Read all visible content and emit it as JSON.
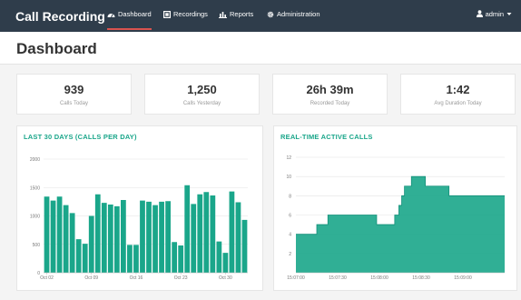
{
  "app": {
    "title": "Call Recording"
  },
  "nav": {
    "items": [
      {
        "label": "Dashboard",
        "icon": "dashboard-icon",
        "active": true
      },
      {
        "label": "Recordings",
        "icon": "recordings-icon",
        "active": false
      },
      {
        "label": "Reports",
        "icon": "bar-chart-icon",
        "active": false
      },
      {
        "label": "Administration",
        "icon": "gear-icon",
        "active": false
      }
    ],
    "user": {
      "label": "admin",
      "icon": "user-icon",
      "caret": "chevron-down-icon"
    }
  },
  "page": {
    "title": "Dashboard"
  },
  "stats": [
    {
      "value": "939",
      "label": "Calls Today"
    },
    {
      "value": "1,250",
      "label": "Calls Yesterday"
    },
    {
      "value": "26h 39m",
      "label": "Recorded Today"
    },
    {
      "value": "1:42",
      "label": "Avg Duration Today"
    }
  ],
  "colors": {
    "navbar": "#2f3d4b",
    "accent": "#1aa68a",
    "active_underline": "#d9534f"
  },
  "chart_data": [
    {
      "type": "bar",
      "title": "LAST 30 DAYS (CALLS PER DAY)",
      "xlabel": "",
      "ylabel": "",
      "ylim": [
        0,
        2000
      ],
      "yticks": [
        0,
        500,
        1000,
        1500,
        2000
      ],
      "xticks": [
        {
          "label": "Oct 02",
          "index": 0
        },
        {
          "label": "Oct 09",
          "index": 7
        },
        {
          "label": "Oct 16",
          "index": 14
        },
        {
          "label": "Oct 23",
          "index": 21
        },
        {
          "label": "Oct 30",
          "index": 28
        }
      ],
      "grid": true,
      "color": "#1aa68a",
      "values": [
        1340,
        1270,
        1340,
        1190,
        1050,
        590,
        510,
        1000,
        1380,
        1230,
        1200,
        1170,
        1280,
        490,
        490,
        1270,
        1250,
        1190,
        1250,
        1260,
        540,
        480,
        1540,
        1210,
        1380,
        1420,
        1360,
        550,
        350,
        1430,
        1240,
        930
      ]
    },
    {
      "type": "area",
      "title": "REAL-TIME ACTIVE CALLS",
      "xlabel": "",
      "ylabel": "",
      "ylim": [
        0,
        12
      ],
      "yticks": [
        2,
        4,
        6,
        8,
        10,
        12
      ],
      "xlim": [
        "15:07:00",
        "15:09:30"
      ],
      "xticks": [
        "15:07:00",
        "15:07:30",
        "15:08:00",
        "15:08:30",
        "15:09:00"
      ],
      "grid": true,
      "step": true,
      "color": "#1aa68a",
      "points": [
        [
          "15:07:00",
          4
        ],
        [
          "15:07:15",
          5
        ],
        [
          "15:07:23",
          6
        ],
        [
          "15:07:58",
          5
        ],
        [
          "15:08:11",
          6
        ],
        [
          "15:08:14",
          7
        ],
        [
          "15:08:16",
          8
        ],
        [
          "15:08:18",
          9
        ],
        [
          "15:08:23",
          10
        ],
        [
          "15:08:33",
          9
        ],
        [
          "15:08:50",
          8
        ],
        [
          "15:09:30",
          8
        ]
      ]
    }
  ]
}
